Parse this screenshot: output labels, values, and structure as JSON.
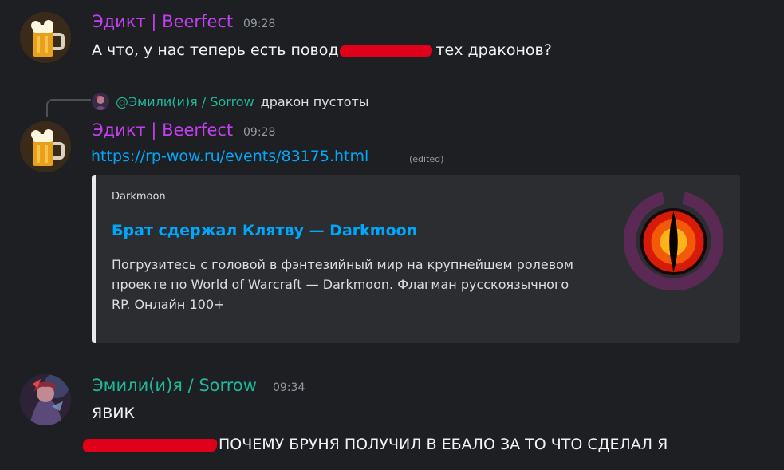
{
  "messages": [
    {
      "author": "Эдикт | Beerfect",
      "time": "09:28",
      "text_before": "А что, у нас теперь есть повод",
      "text_after": "тех драконов?"
    },
    {
      "reply": {
        "author": "@Эмили(и)я / Sorrow",
        "text": "дракон пустоты"
      },
      "author": "Эдикт | Beerfect",
      "time": "09:28",
      "link": "https://rp-wow.ru/events/83175.html",
      "edited": "(edited)",
      "embed": {
        "provider": "Darkmoon",
        "title": "Брат сдержал Клятву — Darkmoon",
        "description": "Погрузитесь с головой в фэнтезийный мир на крупнейшем ролевом проекте по World of Warcraft — Darkmoon. Флагман русскоязычного RP. Онлайн 100+",
        "thumbnail_icon": "dragon-eye-logo-icon"
      }
    },
    {
      "author": "Эмили(и)я / Sorrow",
      "time": "09:34",
      "line1": "ЯВИК",
      "line2_after": "ПОЧЕМУ БРУНЯ ПОЛУЧИЛ В ЕБАЛО ЗА ТО ЧТО СДЕЛАЛ Я"
    }
  ],
  "colors": {
    "background": "#1e1f22",
    "author_purple": "#c43ff2",
    "author_green": "#1fb89a",
    "link": "#00a8fc",
    "redaction": "#e0001a",
    "embed_bg": "#2b2d31"
  }
}
